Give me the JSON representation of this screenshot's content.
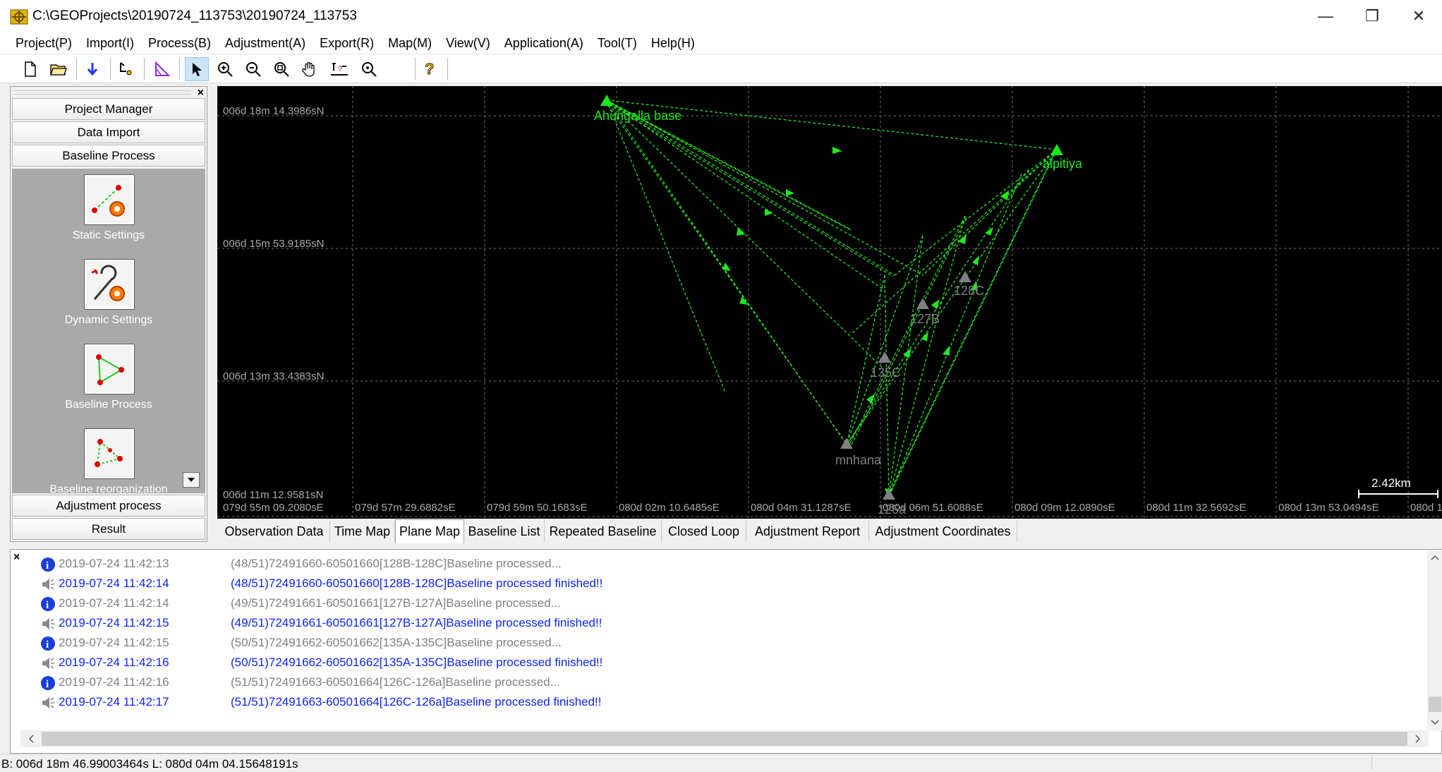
{
  "window": {
    "title": "C:\\GEOProjects\\20190724_113753\\20190724_113753",
    "minimize_glyph": "—",
    "restore_glyph": "❐",
    "close_glyph": "✕"
  },
  "menu": [
    "Project(P)",
    "Import(I)",
    "Process(B)",
    "Adjustment(A)",
    "Export(R)",
    "Map(M)",
    "View(V)",
    "Application(A)",
    "Tool(T)",
    "Help(H)"
  ],
  "toolbar": {
    "icons": [
      "new-file-icon",
      "open-folder-icon",
      "import-arrow-icon",
      "point-tool-icon",
      "triangle-tool-icon",
      "select-pointer-icon",
      "zoom-in-icon",
      "zoom-out-icon",
      "zoom-extent-icon",
      "pan-hand-icon",
      "measure-icon",
      "find-icon",
      "help-icon"
    ]
  },
  "left_panel": {
    "close_glyph": "×",
    "sections": [
      "Project Manager",
      "Data Import",
      "Baseline Process",
      "Adjustment process",
      "Result"
    ],
    "tools": [
      {
        "label": "Static Settings",
        "icon": "static-settings-icon"
      },
      {
        "label": "Dynamic Settings",
        "icon": "dynamic-settings-icon"
      },
      {
        "label": "Baseline Process",
        "icon": "baseline-process-icon"
      },
      {
        "label": "Baseline reorganization",
        "icon": "baseline-reorganization-icon"
      }
    ]
  },
  "map": {
    "lat_labels": [
      "006d 18m 14.3986sN",
      "006d 15m 53.9185sN",
      "006d 13m 33.4383sN",
      "006d 11m 12.9581sN"
    ],
    "lon_labels": [
      "079d 55m 09.2080sE",
      "079d 57m 29.6882sE",
      "079d 59m 50.1683sE",
      "080d 02m 10.6485sE",
      "080d 04m 31.1287sE",
      "080d 06m 51.6088sE",
      "080d 09m 12.0890sE",
      "080d 11m 32.5692sE",
      "080d 13m 53.0494sE",
      "080d 1"
    ],
    "stations": [
      {
        "name": "Ahungalla base",
        "color": "#19e819"
      },
      {
        "name": "alpitiya",
        "color": "#19e819"
      },
      {
        "name": "128C",
        "color": "#808080"
      },
      {
        "name": "127B",
        "color": "#808080"
      },
      {
        "name": "135C",
        "color": "#808080"
      },
      {
        "name": "mnhana",
        "color": "#808080"
      },
      {
        "name": "126a",
        "color": "#808080"
      }
    ],
    "scale_label": "2.42km",
    "line_color": "#1ee81e"
  },
  "tabs": [
    "Observation Data",
    "Time Map",
    "Plane Map",
    "Baseline List",
    "Repeated Baseline",
    "Closed Loop",
    "Adjustment Report",
    "Adjustment Coordinates"
  ],
  "active_tab": "Plane Map",
  "log": {
    "close_glyph": "×",
    "entries": [
      {
        "type": "info",
        "time": "2019-07-24 11:42:13",
        "message": "(48/51)72491660-60501660[128B-128C]Baseline processed..."
      },
      {
        "type": "sound",
        "time": "2019-07-24 11:42:14",
        "message": "(48/51)72491660-60501660[128B-128C]Baseline processed finished!!"
      },
      {
        "type": "info",
        "time": "2019-07-24 11:42:14",
        "message": "(49/51)72491661-60501661[127B-127A]Baseline processed..."
      },
      {
        "type": "sound",
        "time": "2019-07-24 11:42:15",
        "message": "(49/51)72491661-60501661[127B-127A]Baseline processed finished!!"
      },
      {
        "type": "info",
        "time": "2019-07-24 11:42:15",
        "message": "(50/51)72491662-60501662[135A-135C]Baseline processed..."
      },
      {
        "type": "sound",
        "time": "2019-07-24 11:42:16",
        "message": "(50/51)72491662-60501662[135A-135C]Baseline processed finished!!"
      },
      {
        "type": "info",
        "time": "2019-07-24 11:42:16",
        "message": "(51/51)72491663-60501664[126C-126a]Baseline processed..."
      },
      {
        "type": "sound",
        "time": "2019-07-24 11:42:17",
        "message": "(51/51)72491663-60501664[126C-126a]Baseline processed finished!!"
      }
    ],
    "colors": {
      "info": "#808080",
      "finished": "#0b24fb"
    }
  },
  "status": {
    "text": "B: 006d 18m 46.99003464s  L: 080d 04m 04.15648191s"
  }
}
